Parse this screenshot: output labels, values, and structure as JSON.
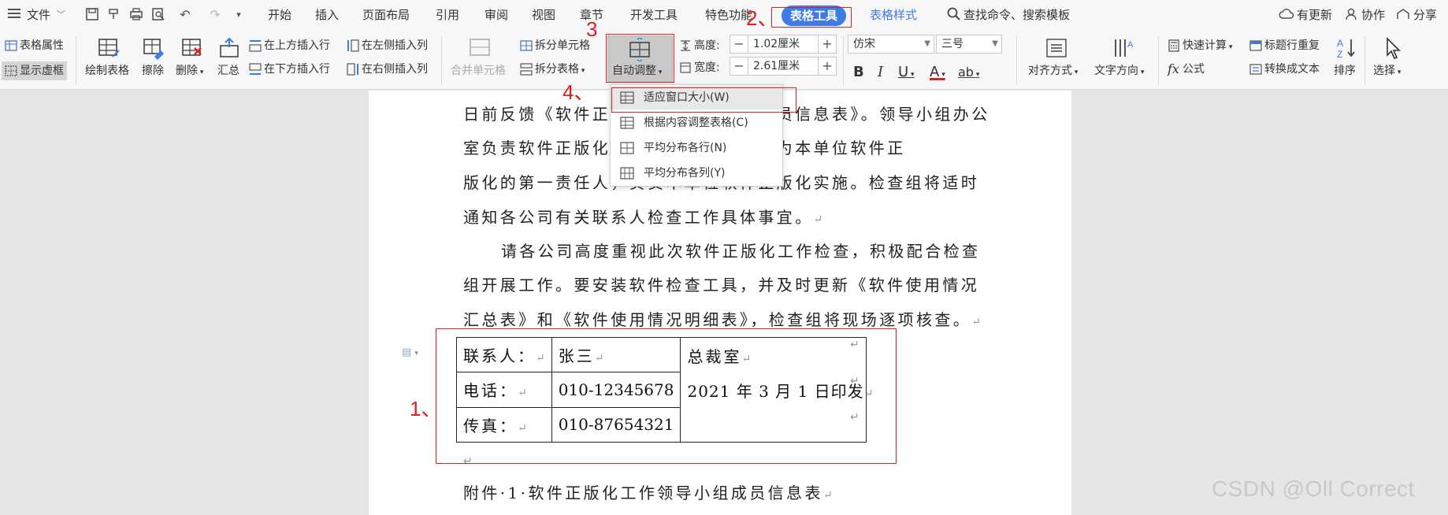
{
  "menubar": {
    "file": "文件",
    "tabs": [
      "开始",
      "插入",
      "页面布局",
      "引用",
      "审阅",
      "视图",
      "章节",
      "开发工具",
      "特色功能"
    ],
    "active_tab": "表格工具",
    "style_tab": "表格样式",
    "search": "查找命令、搜索模板",
    "right": {
      "update": "有更新",
      "collab": "协作",
      "share": "分享"
    }
  },
  "ribbon": {
    "table_props": "表格属性",
    "show_gridlines": "显示虚框",
    "draw_table": "绘制表格",
    "erase": "擦除",
    "delete": "删除",
    "summary": "汇总",
    "insert_above": "在上方插入行",
    "insert_below": "在下方插入行",
    "insert_left": "在左侧插入列",
    "insert_right": "在右侧插入列",
    "merge_cells": "合并单元格",
    "split_cells": "拆分单元格",
    "split_table": "拆分表格",
    "autofit": "自动调整",
    "height_label": "高度:",
    "height_value": "1.02厘米",
    "width_label": "宽度:",
    "width_value": "2.61厘米",
    "font_name": "仿宋",
    "font_size": "三号",
    "bold": "B",
    "italic": "I",
    "underline": "U",
    "font_color": "A",
    "highlight": "ab",
    "align": "对齐方式",
    "text_dir": "文字方向",
    "quick_calc": "快速计算",
    "formula": "公式",
    "repeat_header": "标题行重复",
    "convert_text": "转换成文本",
    "sort": "排序",
    "select": "选择"
  },
  "dropdown": {
    "items": [
      "适应窗口大小(W)",
      "根据内容调整表格(C)",
      "平均分布各行(N)",
      "平均分布各列(Y)"
    ]
  },
  "document": {
    "lines": [
      "日前反馈《软件正版化工作领导小组成员信息表》。领导小组办公",
      "室负责软件正版化工作，各单位负责人为本单位软件正",
      "版化的第一责任人，负责本单位软件正版化实施。检查组将适时",
      "通知各公司有关联系人检查工作具体事宜。",
      "请各公司高度重视此次软件正版化工作检查，积极配合检查",
      "组开展工作。要安装软件检查工具，并及时更新《软件使用情况",
      "汇总表》和《软件使用情况明细表》，检查组将现场逐项核查。",
      "附件·1·软件正版化工作领导小组成员信息表"
    ],
    "table": {
      "r1c1": "联系人：",
      "r1c2": "张三",
      "r2c1": "电话：",
      "r2c2": "010-12345678",
      "r3c1": "传真：",
      "r3c2": "010-87654321",
      "c3a": "总裁室",
      "c3b": "2021 年 3 月 1 日印发"
    }
  },
  "annotations": [
    "1、",
    "2、",
    "3",
    "4、"
  ],
  "watermark": "CSDN @Oll Correct",
  "colors": {
    "accent": "#3d7be6",
    "annotation": "#e02020"
  }
}
